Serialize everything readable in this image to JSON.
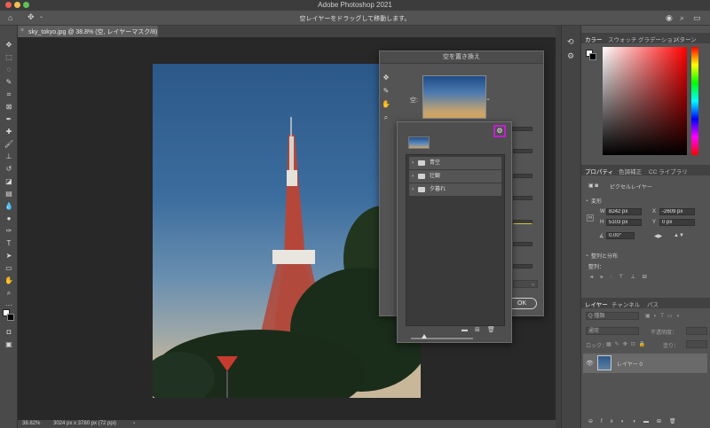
{
  "app": {
    "title": "Adobe Photoshop 2021"
  },
  "colors": {
    "accent_highlight": "#c41fcf",
    "red_dot": "#ee5c54",
    "yellow_dot": "#f4be4f",
    "green_dot": "#5fc454"
  },
  "options_bar": {
    "hint": "空レイヤーをドラッグして移動します。"
  },
  "document": {
    "tab_label": "sky_tokyo.jpg @ 38.8% (空, レイヤーマスク/8) *",
    "zoom": "38.82%",
    "doc_info": "3024 px x 3780 px (72 ppi)"
  },
  "sky_dialog": {
    "title": "空を置き換え",
    "sky_label": "空:",
    "ok_label": "OK"
  },
  "preset_popup": {
    "groups": [
      {
        "label": "青空"
      },
      {
        "label": "壮観"
      },
      {
        "label": "夕暮れ"
      }
    ]
  },
  "panels": {
    "top_tabs": [
      "カラー",
      "スウォッチ",
      "グラデーション",
      "パターン"
    ],
    "props_tabs": [
      "プロパティ",
      "色調補正",
      "CC ライブラリ"
    ],
    "properties": {
      "layer_kind": "ピクセルレイヤー",
      "transform_label": "変形",
      "w_label": "W",
      "w_value": "8242 px",
      "x_label": "X",
      "x_value": "-2609 px",
      "h_label": "H",
      "h_value": "5103 px",
      "y_label": "Y",
      "y_value": "0 px",
      "angle_value": "0.00°",
      "align_label": "整列と分布",
      "align_sub": "整列："
    },
    "layers_tabs": [
      "レイヤー",
      "チャンネル",
      "パス"
    ],
    "layers": {
      "search_placeholder": "Q 種類",
      "blend_mode": "通常",
      "opacity_label": "不透明度：",
      "lock_label": "ロック：",
      "fill_label": "塗り：",
      "layer_name": "レイヤー 0"
    }
  }
}
